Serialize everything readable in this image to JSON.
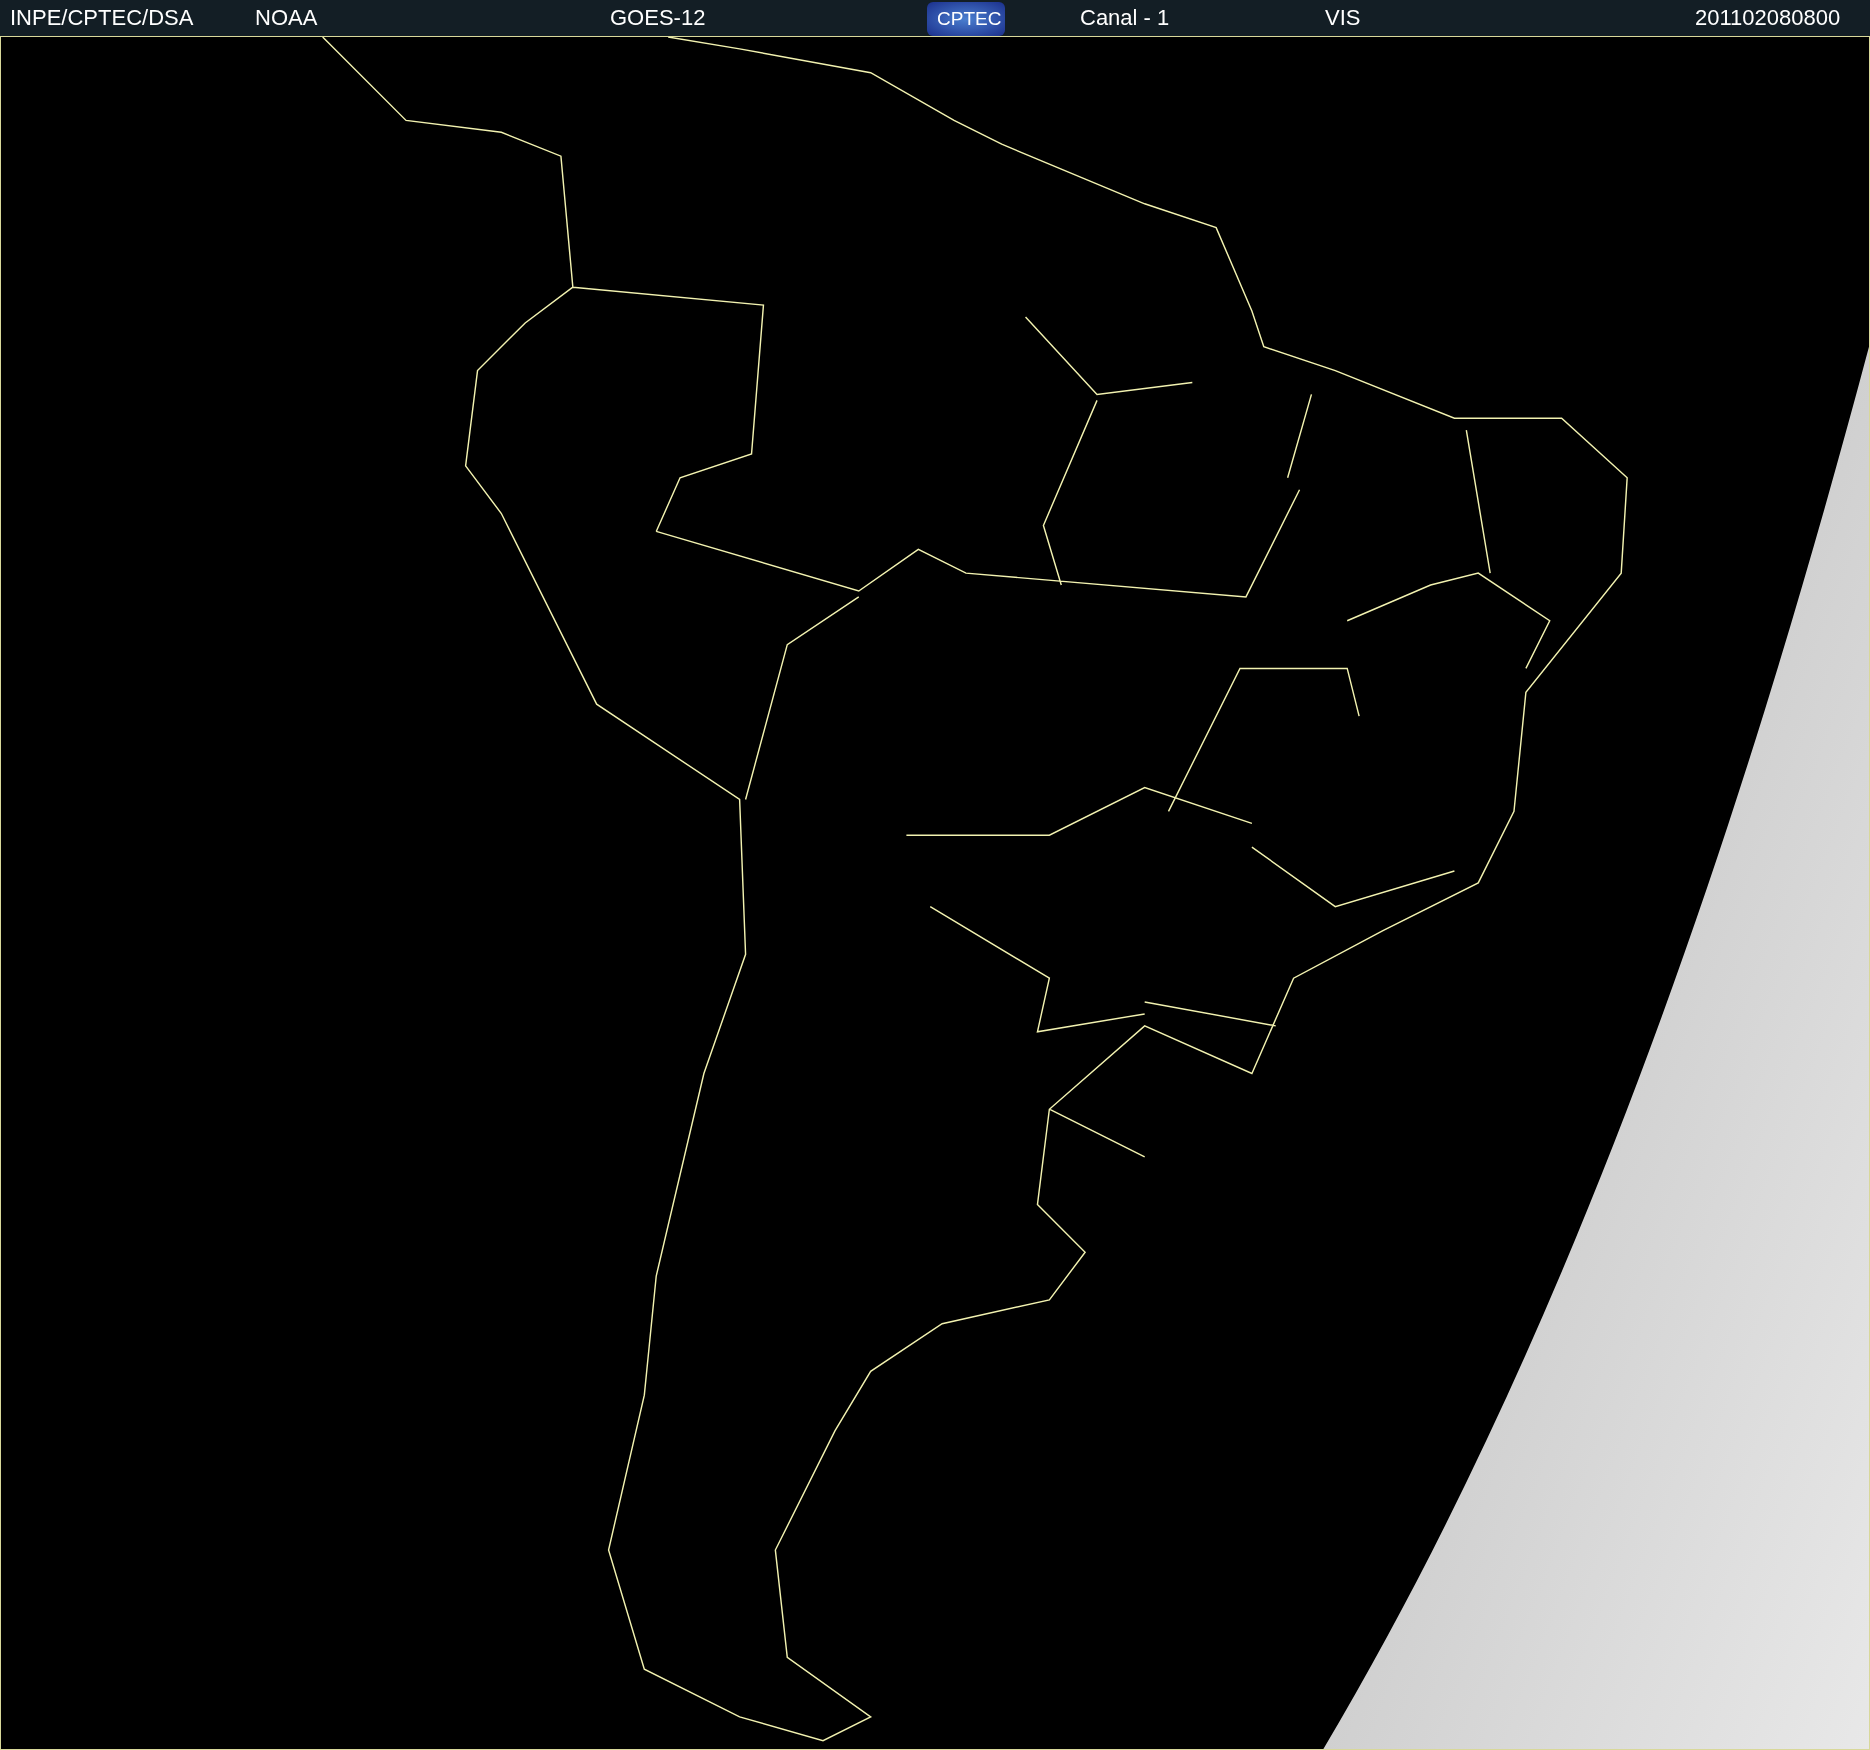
{
  "header": {
    "items": [
      {
        "kind": "text",
        "label": "INPE/CPTEC/DSA"
      },
      {
        "kind": "text",
        "label": "NOAA"
      },
      {
        "kind": "text",
        "label": "GOES-12"
      },
      {
        "kind": "logo",
        "label": "CPTEC"
      },
      {
        "kind": "text",
        "label": "Canal - 1"
      },
      {
        "kind": "text",
        "label": "VIS"
      },
      {
        "kind": "text",
        "label": "201102080800"
      }
    ]
  }
}
